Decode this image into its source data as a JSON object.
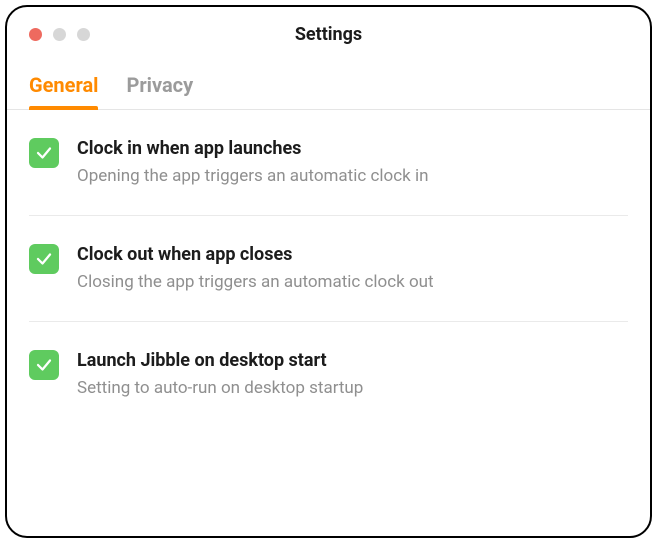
{
  "window": {
    "title": "Settings"
  },
  "tabs": [
    {
      "label": "General",
      "active": true
    },
    {
      "label": "Privacy",
      "active": false
    }
  ],
  "settings": [
    {
      "checked": true,
      "title": "Clock in when app launches",
      "description": "Opening the app triggers an automatic clock in"
    },
    {
      "checked": true,
      "title": "Clock out when app closes",
      "description": "Closing the app triggers an automatic clock out"
    },
    {
      "checked": true,
      "title": "Launch Jibble on desktop start",
      "description": "Setting to auto-run on desktop startup"
    }
  ]
}
